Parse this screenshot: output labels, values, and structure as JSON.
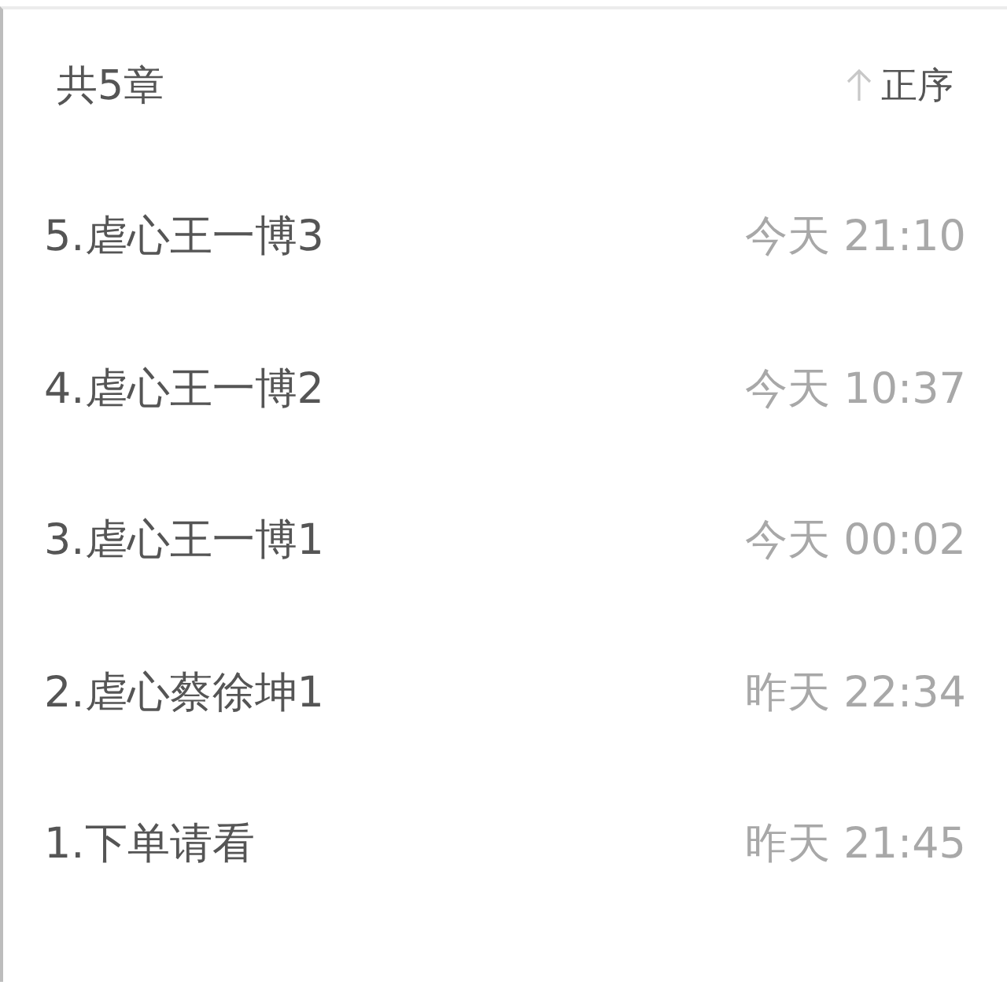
{
  "header": {
    "count": "共5章",
    "sort": {
      "label": "正序"
    }
  },
  "chapters": [
    {
      "title": "5.虐心王一博3",
      "time": "今天 21:10"
    },
    {
      "title": "4.虐心王一博2",
      "time": "今天 10:37"
    },
    {
      "title": "3.虐心王一博1",
      "time": "今天 00:02"
    },
    {
      "title": "2.虐心蔡徐坤1",
      "time": "昨天 22:34"
    },
    {
      "title": "1.下单请看",
      "time": "昨天 21:45"
    }
  ]
}
